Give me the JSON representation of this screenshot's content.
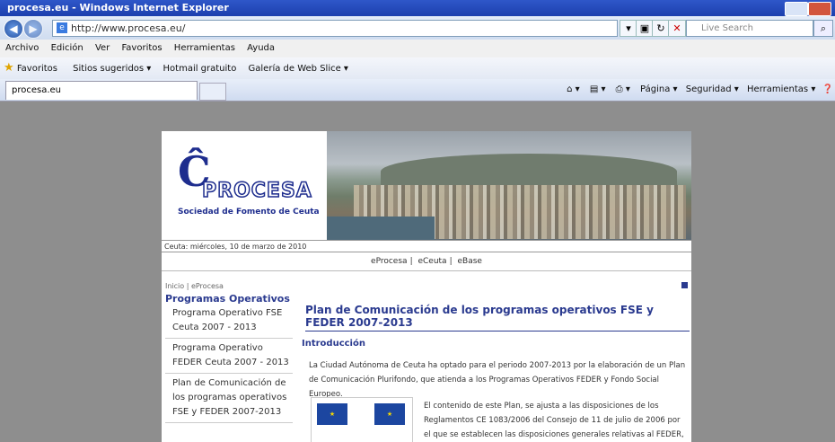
{
  "window": {
    "title": "procesa.eu - Windows Internet Explorer"
  },
  "address": {
    "url": "http://www.procesa.eu/",
    "search_placeholder": "Live Search"
  },
  "menu": [
    "Archivo",
    "Edición",
    "Ver",
    "Favoritos",
    "Herramientas",
    "Ayuda"
  ],
  "favorites": {
    "label": "Favoritos",
    "items": [
      "Sitios sugeridos ▾",
      "Hotmail gratuito",
      "Galería de Web Slice ▾"
    ]
  },
  "tab": {
    "label": "procesa.eu"
  },
  "toolbar": {
    "page": "Página ▾",
    "security": "Seguridad ▾",
    "tools": "Herramientas ▾"
  },
  "site": {
    "logo_name": "PROCESA",
    "logo_sub": "Sociedad de Fomento de Ceuta",
    "date": "Ceuta: miércoles, 10 de marzo de 2010",
    "nav": [
      "eProcesa",
      "eCeuta",
      "eBase"
    ],
    "breadcrumb": "Inicio | eProcesa",
    "section": "Programas Operativos",
    "sidebar": [
      "Programa Operativo FSE Ceuta 2007 - 2013",
      "Programa Operativo FEDER Ceuta 2007 - 2013",
      "Plan de Comunicación de los programas operativos FSE y FEDER 2007-2013"
    ],
    "page_title": "Plan de Comunicación de los programas operativos FSE y FEDER 2007-2013",
    "intro_heading": "Introducción",
    "para1": "La Ciudad Autónoma de Ceuta ha optado para el periodo 2007-2013 por la elaboración de un Plan de Comunicación Plurifondo, que atienda a los Programas Operativos FEDER y Fondo Social Europeo.",
    "para2": "El contenido de este Plan, se ajusta a las disposiciones de los Reglamentos CE 1083/2006 del Consejo de 11 de julio de 2006 por el que se establecen las disposiciones generales relativas al FEDER, FSE y"
  }
}
